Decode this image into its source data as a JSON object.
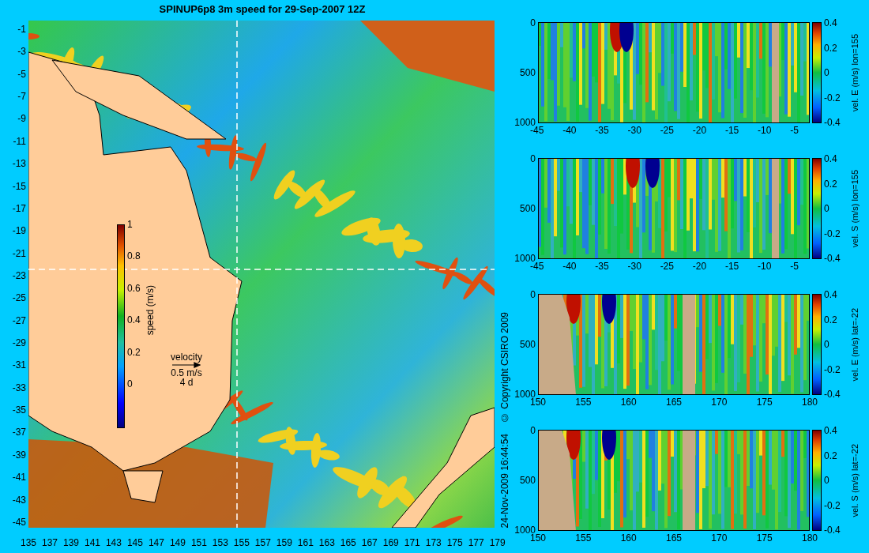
{
  "map": {
    "title": "SPINUP6p8 3m speed for 29-Sep-2007 12Z",
    "y_ticks": [
      "-1",
      "-3",
      "-5",
      "-7",
      "-9",
      "-11",
      "-13",
      "-15",
      "-17",
      "-19",
      "-21",
      "-23",
      "-25",
      "-27",
      "-29",
      "-31",
      "-33",
      "-35",
      "-37",
      "-39",
      "-41",
      "-43",
      "-45"
    ],
    "x_ticks": [
      "135",
      "137",
      "139",
      "141",
      "143",
      "145",
      "147",
      "149",
      "151",
      "153",
      "155",
      "157",
      "159",
      "161",
      "163",
      "165",
      "167",
      "169",
      "171",
      "173",
      "175",
      "177",
      "179"
    ],
    "colorbar": {
      "label": "speed (m/s)",
      "ticks": [
        "1",
        "0.8",
        "0.6",
        "0.4",
        "0.2",
        "0"
      ]
    },
    "velocity_key": {
      "label": "velocity",
      "speed": "0.5 m/s",
      "interval": "4 d"
    }
  },
  "stamp": {
    "copyright": "© Copyright CSIRO 2009",
    "date": "24-Nov-2009 16:44:54"
  },
  "sections": [
    {
      "kind": "lon",
      "label": "vel. E (m/s) lon=155",
      "y_ticks": [
        "0",
        "500",
        "1000"
      ],
      "x_ticks": [
        "-45",
        "-40",
        "-35",
        "-30",
        "-25",
        "-20",
        "-15",
        "-10",
        "-5"
      ],
      "colorbar_ticks": [
        "0.4",
        "0.2",
        "0",
        "-0.2",
        "-0.4"
      ]
    },
    {
      "kind": "lon",
      "label": "vel. S (m/s) lon=155",
      "y_ticks": [
        "0",
        "500",
        "1000"
      ],
      "x_ticks": [
        "-45",
        "-40",
        "-35",
        "-30",
        "-25",
        "-20",
        "-15",
        "-10",
        "-5"
      ],
      "colorbar_ticks": [
        "0.4",
        "0.2",
        "0",
        "-0.2",
        "-0.4"
      ]
    },
    {
      "kind": "lat",
      "label": "vel. E (m/s) lat=-22",
      "y_ticks": [
        "0",
        "500",
        "1000"
      ],
      "x_ticks": [
        "150",
        "155",
        "160",
        "165",
        "170",
        "175",
        "180"
      ],
      "colorbar_ticks": [
        "0.4",
        "0.2",
        "0",
        "-0.2",
        "-0.4"
      ]
    },
    {
      "kind": "lat",
      "label": "vel. S (m/s) lat=-22",
      "y_ticks": [
        "0",
        "500",
        "1000"
      ],
      "x_ticks": [
        "150",
        "155",
        "160",
        "165",
        "170",
        "175",
        "180"
      ],
      "colorbar_ticks": [
        "0.4",
        "0.2",
        "0",
        "-0.2",
        "-0.4"
      ]
    }
  ]
}
